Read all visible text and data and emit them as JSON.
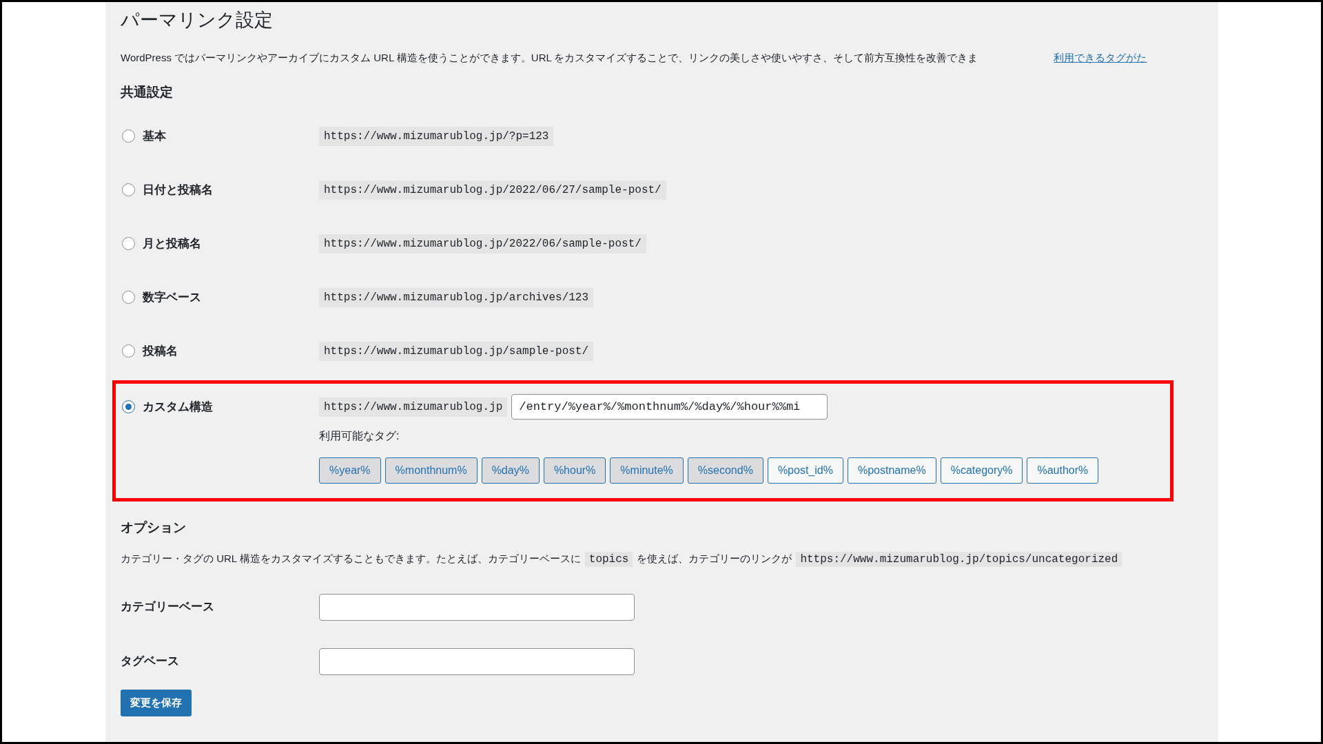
{
  "title": "パーマリンク設定",
  "intro": {
    "text": "WordPress ではパーマリンクやアーカイブにカスタム URL 構造を使うことができます。URL をカスタマイズすることで、リンクの美しさや使いやすさ、そして前方互換性を改善できま",
    "link": "利用できるタグがた"
  },
  "common_heading": "共通設定",
  "options": [
    {
      "label": "基本",
      "url": "https://www.mizumarublog.jp/?p=123",
      "selected": false
    },
    {
      "label": "日付と投稿名",
      "url": "https://www.mizumarublog.jp/2022/06/27/sample-post/",
      "selected": false
    },
    {
      "label": "月と投稿名",
      "url": "https://www.mizumarublog.jp/2022/06/sample-post/",
      "selected": false
    },
    {
      "label": "数字ベース",
      "url": "https://www.mizumarublog.jp/archives/123",
      "selected": false
    },
    {
      "label": "投稿名",
      "url": "https://www.mizumarublog.jp/sample-post/",
      "selected": false
    }
  ],
  "custom": {
    "label": "カスタム構造",
    "selected": true,
    "base": "https://www.mizumarublog.jp",
    "value": "/entry/%year%/%monthnum%/%day%/%hour%%mi",
    "tags_label": "利用可能なタグ:",
    "tags": [
      {
        "label": "%year%",
        "selected": true
      },
      {
        "label": "%monthnum%",
        "selected": true
      },
      {
        "label": "%day%",
        "selected": true
      },
      {
        "label": "%hour%",
        "selected": true
      },
      {
        "label": "%minute%",
        "selected": true
      },
      {
        "label": "%second%",
        "selected": true
      },
      {
        "label": "%post_id%",
        "selected": false
      },
      {
        "label": "%postname%",
        "selected": false
      },
      {
        "label": "%category%",
        "selected": false
      },
      {
        "label": "%author%",
        "selected": false
      }
    ]
  },
  "optional": {
    "heading": "オプション",
    "text_before": "カテゴリー・タグの URL 構造をカスタマイズすることもできます。たとえば、カテゴリーベースに",
    "code": "topics",
    "text_middle": "を使えば、カテゴリーのリンクが",
    "url": "https://www.mizumarublog.jp/topics/uncategorized",
    "fields": [
      {
        "label": "カテゴリーベース"
      },
      {
        "label": "タグベース"
      }
    ]
  },
  "save_button": "変更を保存"
}
